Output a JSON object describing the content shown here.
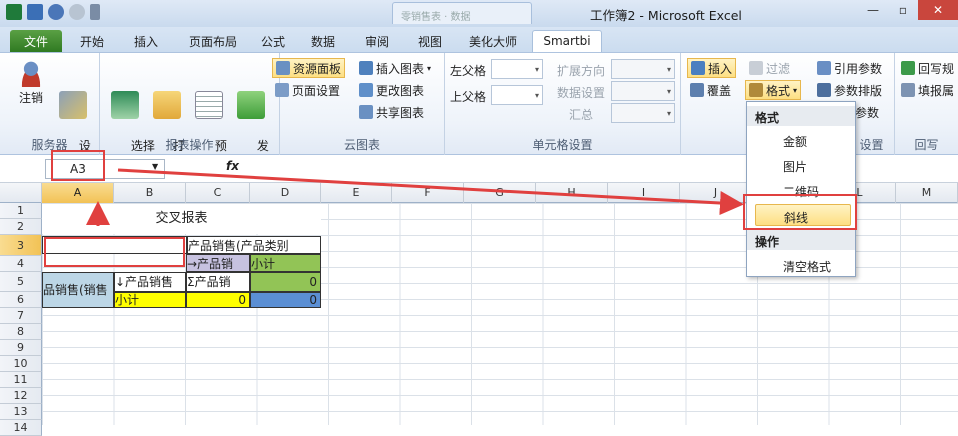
{
  "window": {
    "title": "工作簿2 - Microsoft Excel",
    "blurred_tab": "零销售表 · 数据"
  },
  "ribbon_tabs": [
    "文件",
    "开始",
    "插入",
    "页面布局",
    "公式",
    "数据",
    "审阅",
    "视图",
    "美化大师",
    "Smartbi"
  ],
  "groups": {
    "server": {
      "label": "服务器",
      "buttons": [
        "注销",
        "设\n置"
      ]
    },
    "report_ops": {
      "label": "报表操作",
      "buttons": [
        "选择\n模板",
        "打\n开",
        "预\n览",
        "发\n布"
      ]
    },
    "cloud": {
      "label": "云图表",
      "buttons": [
        "资源面板",
        "页面设置",
        "插入图表",
        "更改图表",
        "共享图表"
      ]
    },
    "cell_settings": {
      "label": "单元格设置",
      "left_parent": "左父格",
      "top_parent": "上父格",
      "expand_dir": "扩展方向",
      "data_setting": "数据设置",
      "summary": "汇总"
    },
    "insert": {
      "insert": "插入",
      "cover": "覆盖",
      "filter": "过滤",
      "format": "格式"
    },
    "params": {
      "label": "设置",
      "ref": "引用参数",
      "layout": "参数排版",
      "from": "从参数"
    },
    "writeback": {
      "label": "回写",
      "r1": "回写规",
      "r2": "填报属"
    }
  },
  "formula_bar": {
    "name_box": "A3",
    "fx": "fx"
  },
  "columns": [
    "A",
    "B",
    "C",
    "D",
    "E",
    "F",
    "G",
    "H",
    "I",
    "J",
    "K",
    "L",
    "M"
  ],
  "rows": [
    "1",
    "2",
    "3",
    "4",
    "5",
    "6",
    "7",
    "8",
    "9",
    "10",
    "11",
    "12",
    "13",
    "14"
  ],
  "cells": {
    "title": "交叉报表",
    "c3": "产品销售(产品类别",
    "c4": "→产品销",
    "d4": "小计",
    "a5": "品销售(销售",
    "b5": "↓产品销售",
    "c5": "Σ产品销",
    "d5": "0",
    "b6": "小计",
    "c6": "0",
    "d6": "0"
  },
  "format_menu": {
    "header1": "格式",
    "items": [
      "金额",
      "图片",
      "二维码"
    ],
    "highlight": "斜线",
    "header2": "操作",
    "clear": "清空格式"
  }
}
